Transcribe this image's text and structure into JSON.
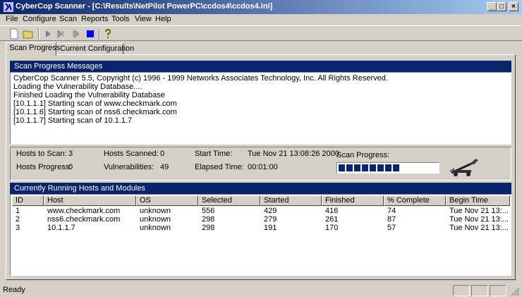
{
  "window": {
    "title": "CyberCop Scanner - [C:\\Results\\NetPilot PowerPC\\ccdos4\\ccdos4.ini]",
    "min_glyph": "_",
    "max_glyph": "□",
    "close_glyph": "×"
  },
  "menu": [
    "File",
    "Configure",
    "Scan",
    "Reports",
    "Tools",
    "View",
    "Help"
  ],
  "toolbar": {
    "icons": [
      "new-file-icon",
      "open-folder-icon",
      "start-scan-icon",
      "step-forward-icon",
      "step-next-icon",
      "stop-scan-icon",
      "help-icon"
    ],
    "stop_color": "#0000ff",
    "help_color": "#c0a000"
  },
  "tabs": [
    {
      "label": "Scan Progress",
      "active": true
    },
    {
      "label": "Current Configuration",
      "active": false
    }
  ],
  "messages": {
    "header": "Scan Progress Messages",
    "lines": [
      "CyberCop Scanner 5.5, Copyright (c) 1996 - 1999 Networks Associates Technology, Inc. All Rights Reserved.",
      "Loading the Vulnerability Database....",
      "Finished Loading the Vulnerability Database",
      "[10.1.1.1] Starting scan of www.checkmark.com",
      "[10.1.1.6] Starting scan of nss6.checkmark.com",
      "[10.1.1.7] Starting scan of 10.1.1.7"
    ]
  },
  "stats": {
    "hosts_to_scan_label": "Hosts to Scan:",
    "hosts_to_scan": "3",
    "hosts_scanned_label": "Hosts Scanned:",
    "hosts_scanned": "0",
    "start_time_label": "Start Time:",
    "start_time": "Tue Nov 21 13:08:26 2000",
    "scan_progress_label": "Scan Progress:",
    "hosts_progress_label": "Hosts Progress:",
    "hosts_progress": "0",
    "vulnerabilities_label": "Vulnerabilities:",
    "vulnerabilities": "49",
    "elapsed_time_label": "Elapsed Time:",
    "elapsed_time": "00:01:00",
    "scan_progress_segments": 8,
    "progress_color": "#0a246a"
  },
  "hosts": {
    "header": "Currently Running Hosts and Modules",
    "columns": [
      "ID",
      "Host",
      "OS",
      "Selected",
      "Started",
      "Finished",
      "% Complete",
      "Begin Time"
    ],
    "rows": [
      [
        "1",
        "www.checkmark.com",
        "unknown",
        "556",
        "429",
        "416",
        "74",
        "Tue Nov 21 13:..."
      ],
      [
        "2",
        "nss6.checkmark.com",
        "unknown",
        "298",
        "279",
        "261",
        "87",
        "Tue Nov 21 13:..."
      ],
      [
        "3",
        "10.1.1.7",
        "unknown",
        "298",
        "191",
        "170",
        "57",
        "Tue Nov 21 13:..."
      ]
    ]
  },
  "status": {
    "text": "Ready"
  },
  "colors": {
    "titlebar": "#0a246a",
    "face": "#d4d0c8",
    "header": "#0a246a"
  }
}
